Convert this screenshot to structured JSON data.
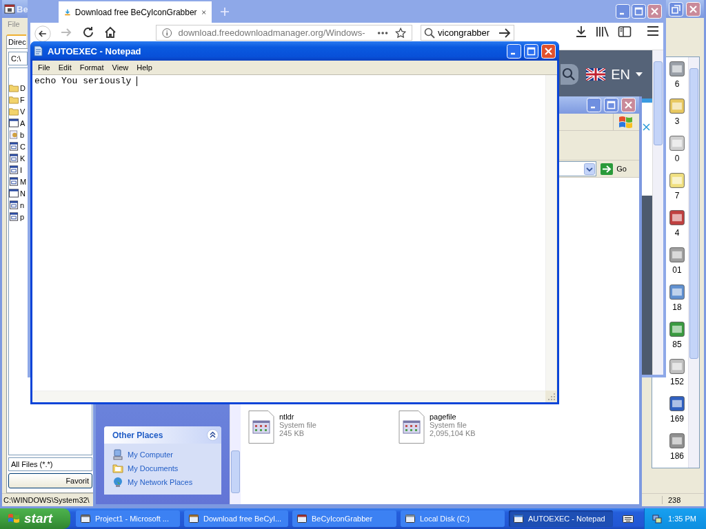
{
  "background_app": {
    "title": "Be",
    "menu": [
      "File"
    ],
    "tab": "Direc",
    "path_field": "C:\\",
    "file_items": [
      {
        "label": "D",
        "kind": "folder"
      },
      {
        "label": "F",
        "kind": "folder"
      },
      {
        "label": "V",
        "kind": "folder"
      },
      {
        "label": "A",
        "kind": "app"
      },
      {
        "label": "b",
        "kind": "script"
      },
      {
        "label": "C",
        "kind": "doc"
      },
      {
        "label": "K",
        "kind": "doc"
      },
      {
        "label": "I",
        "kind": "doc"
      },
      {
        "label": "M",
        "kind": "doc"
      },
      {
        "label": "N",
        "kind": "app"
      },
      {
        "label": "n",
        "kind": "doc"
      },
      {
        "label": "p",
        "kind": "doc"
      }
    ],
    "filter": "All Files (*.*)",
    "button": "Favorit",
    "status_path": "C:\\WINDOWS\\System32\\",
    "status_count": "238",
    "icon_labels": [
      "6",
      "3",
      "0",
      "7",
      "4",
      "01",
      "18",
      "85",
      "152",
      "169",
      "186"
    ]
  },
  "browser": {
    "tab_title": "Download free BeCyIconGrabber",
    "url": "download.freedownloadmanager.org/Windows-",
    "search": "vicongrabber",
    "language": "EN"
  },
  "explorer": {
    "go_button": "Go",
    "other_places": {
      "title": "Other Places",
      "expanded": true,
      "links": [
        "My Computer",
        "My Documents",
        "My Network Places"
      ]
    },
    "files": [
      {
        "name": "ntldr",
        "type": "System file",
        "size": "245 KB"
      },
      {
        "name": "pagefile",
        "type": "System file",
        "size": "2,095,104 KB"
      }
    ]
  },
  "notepad": {
    "title": "AUTOEXEC - Notepad",
    "menu": [
      "File",
      "Edit",
      "Format",
      "View",
      "Help"
    ],
    "text": "echo You seriously "
  },
  "taskbar": {
    "start": "start",
    "items": [
      {
        "label": "Project1 - Microsoft ...",
        "selected": false
      },
      {
        "label": "Download free BeCyI...",
        "selected": false
      },
      {
        "label": "BeCyIconGrabber",
        "selected": false
      },
      {
        "label": "Local Disk (C:)",
        "selected": false
      },
      {
        "label": "AUTOEXEC - Notepad",
        "selected": true
      }
    ],
    "clock": "1:35 PM"
  }
}
